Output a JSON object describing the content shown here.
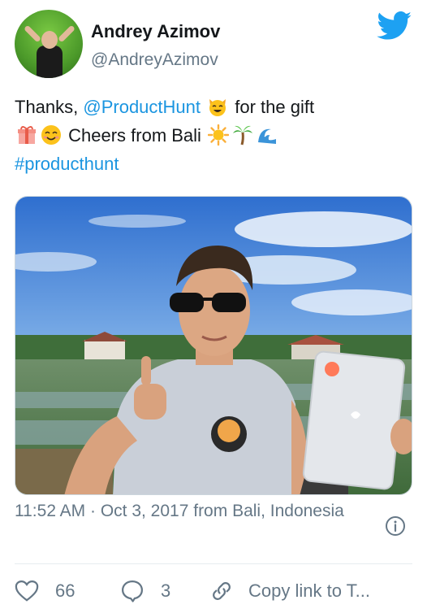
{
  "user": {
    "display_name": "Andrey Azimov",
    "handle": "@AndreyAzimov"
  },
  "tweet": {
    "text_1": "Thanks, ",
    "mention": "@ProductHunt",
    "text_2": " for the gift",
    "text_3": " Cheers from Bali ",
    "hashtag": "#producthunt"
  },
  "meta": {
    "timestamp": "11:52 AM · Oct 3, 2017 from Bali, Indonesia"
  },
  "actions": {
    "like_count": "66",
    "reply_count": "3",
    "copy_label": "Copy link to T..."
  },
  "colors": {
    "brand": "#1da1f2",
    "link": "#1b95e0",
    "secondary_text": "#657786"
  },
  "icons": {
    "bird": "twitter-bird-icon",
    "info": "info-icon",
    "like": "heart-icon",
    "reply": "speech-bubble-icon",
    "copy": "link-icon"
  }
}
